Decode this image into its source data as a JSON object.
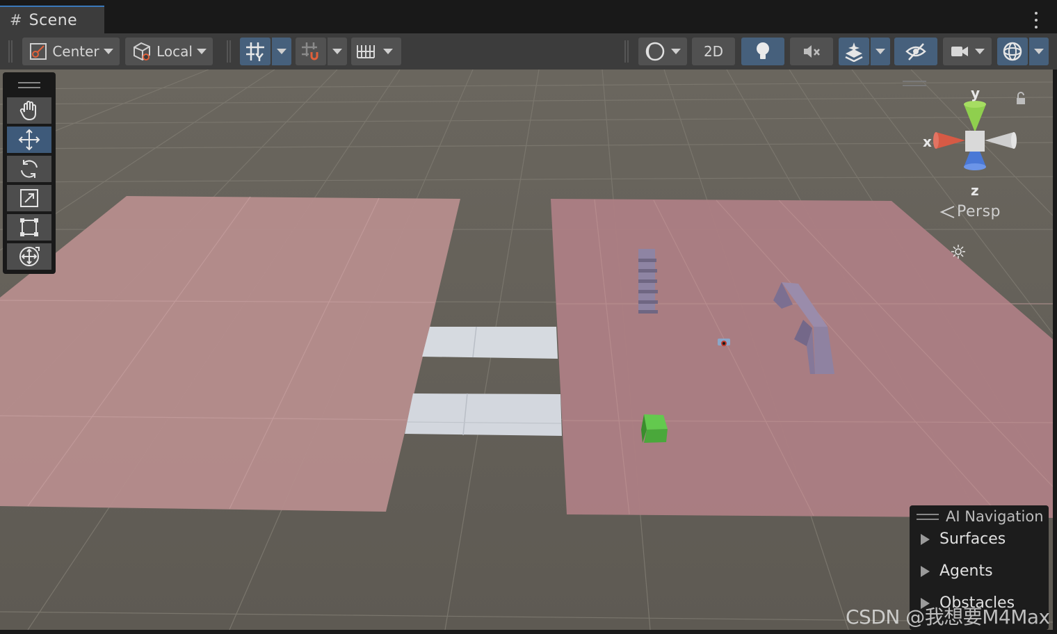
{
  "window": {
    "tab_title": "Scene",
    "tab_icon": "grid-hash-icon"
  },
  "toolbar": {
    "pivot_mode": "Center",
    "pivot_rotation": "Local",
    "toggle_2d": "2D",
    "icons": [
      "grid-snap-icon",
      "increment-snap-icon",
      "grid-ruler-icon",
      "shading-mode-icon",
      "lighting-icon",
      "audio-mute-icon",
      "effects-layers-icon",
      "visibility-hidden-icon",
      "camera-icon",
      "gizmos-icon"
    ]
  },
  "tools": {
    "items": [
      "hand-tool",
      "move-tool",
      "rotate-tool",
      "scale-tool",
      "rect-tool",
      "transform-tool"
    ],
    "active": "move-tool"
  },
  "gizmo": {
    "y_label": "y",
    "x_label": "x",
    "z_label": "z",
    "projection": "Persp"
  },
  "ai_navigation": {
    "title": "AI Navigation",
    "items": [
      "Surfaces",
      "Agents",
      "Obstacles"
    ]
  },
  "watermark": "CSDN @我想要M4Max",
  "colors": {
    "ground": "#646058",
    "navmesh": "#b28a8c",
    "active_button": "#46607c",
    "cube": "#4fb53f"
  }
}
